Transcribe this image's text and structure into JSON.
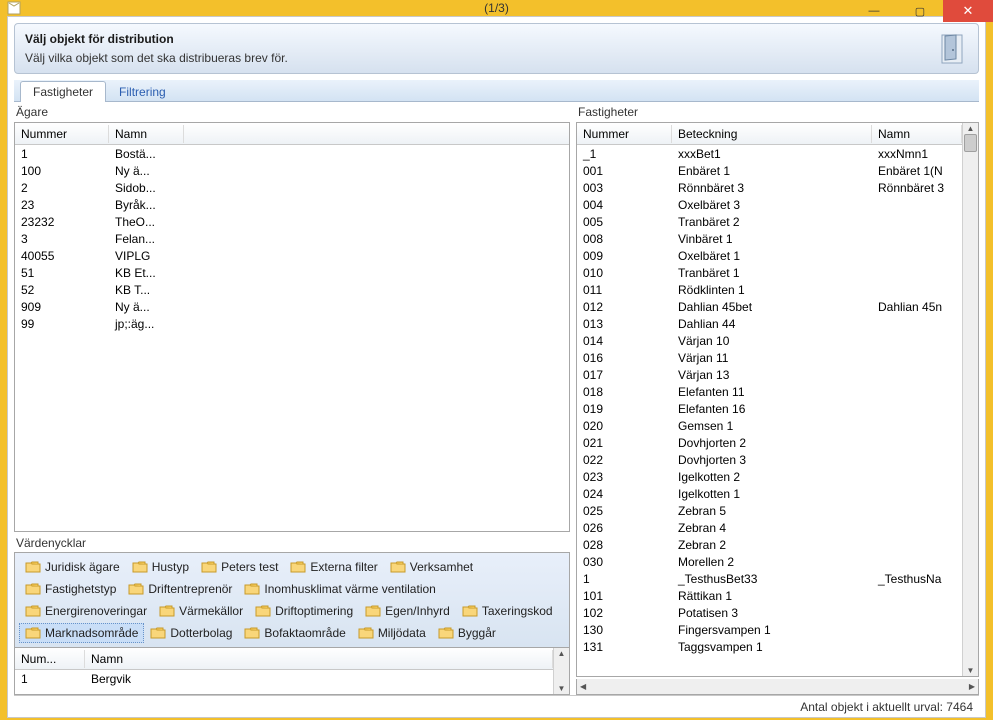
{
  "window": {
    "title": "(1/3)"
  },
  "header": {
    "title": "Välj objekt för distribution",
    "subtitle": "Välj vilka objekt som det ska distribueras brev för."
  },
  "tabs": [
    {
      "label": "Fastigheter",
      "active": true
    },
    {
      "label": "Filtrering",
      "active": false
    }
  ],
  "owners": {
    "label": "Ägare",
    "columns": {
      "num": "Nummer",
      "namn": "Namn"
    },
    "rows": [
      {
        "num": "1",
        "namn": "Bostä..."
      },
      {
        "num": "100",
        "namn": "Ny ä..."
      },
      {
        "num": "2",
        "namn": "Sidob..."
      },
      {
        "num": "23",
        "namn": "Byråk..."
      },
      {
        "num": "23232",
        "namn": "TheO..."
      },
      {
        "num": "3",
        "namn": "Felan..."
      },
      {
        "num": "40055",
        "namn": "VIPLG"
      },
      {
        "num": "51",
        "namn": "KB Et..."
      },
      {
        "num": "52",
        "namn": "KB T..."
      },
      {
        "num": "909",
        "namn": "Ny ä..."
      },
      {
        "num": "99",
        "namn": "jp;:äg..."
      }
    ]
  },
  "value_keys": {
    "label": "Värdenycklar",
    "items": [
      {
        "label": "Juridisk ägare"
      },
      {
        "label": "Hustyp"
      },
      {
        "label": "Peters test"
      },
      {
        "label": "Externa filter"
      },
      {
        "label": "Verksamhet"
      },
      {
        "label": "Fastighetstyp"
      },
      {
        "label": "Driftentreprenör"
      },
      {
        "label": "Inomhusklimat värme ventilation"
      },
      {
        "label": "Energirenoveringar"
      },
      {
        "label": "Värmekällor"
      },
      {
        "label": "Driftoptimering"
      },
      {
        "label": "Egen/Inhyrd"
      },
      {
        "label": "Taxeringskod"
      },
      {
        "label": "Marknadsområde",
        "selected": true
      },
      {
        "label": "Dotterbolag"
      },
      {
        "label": "Bofaktaområde"
      },
      {
        "label": "Miljödata"
      },
      {
        "label": "Byggår"
      }
    ],
    "grid": {
      "columns": {
        "num": "Num...",
        "namn": "Namn"
      },
      "rows": [
        {
          "num": "1",
          "namn": "Bergvik"
        }
      ]
    }
  },
  "properties": {
    "label": "Fastigheter",
    "columns": {
      "num": "Nummer",
      "bet": "Beteckning",
      "namn": "Namn"
    },
    "rows": [
      {
        "num": "_1",
        "bet": "xxxBet1",
        "namn": "xxxNmn1"
      },
      {
        "num": "001",
        "bet": "Enbäret 1",
        "namn": "Enbäret 1(N"
      },
      {
        "num": "003",
        "bet": "Rönnbäret 3",
        "namn": "Rönnbäret 3"
      },
      {
        "num": "004",
        "bet": "Oxelbäret 3",
        "namn": ""
      },
      {
        "num": "005",
        "bet": "Tranbäret 2",
        "namn": ""
      },
      {
        "num": "008",
        "bet": "Vinbäret 1",
        "namn": ""
      },
      {
        "num": "009",
        "bet": "Oxelbäret 1",
        "namn": ""
      },
      {
        "num": "010",
        "bet": "Tranbäret 1",
        "namn": ""
      },
      {
        "num": "011",
        "bet": "Rödklinten 1",
        "namn": ""
      },
      {
        "num": "012",
        "bet": "Dahlian 45bet",
        "namn": "Dahlian 45n"
      },
      {
        "num": "013",
        "bet": "Dahlian 44",
        "namn": ""
      },
      {
        "num": "014",
        "bet": "Värjan 10",
        "namn": ""
      },
      {
        "num": "016",
        "bet": "Värjan 11",
        "namn": ""
      },
      {
        "num": "017",
        "bet": "Värjan 13",
        "namn": ""
      },
      {
        "num": "018",
        "bet": "Elefanten 11",
        "namn": ""
      },
      {
        "num": "019",
        "bet": "Elefanten 16",
        "namn": ""
      },
      {
        "num": "020",
        "bet": "Gemsen 1",
        "namn": ""
      },
      {
        "num": "021",
        "bet": "Dovhjorten 2",
        "namn": ""
      },
      {
        "num": "022",
        "bet": "Dovhjorten 3",
        "namn": ""
      },
      {
        "num": "023",
        "bet": "Igelkotten 2",
        "namn": ""
      },
      {
        "num": "024",
        "bet": "Igelkotten 1",
        "namn": ""
      },
      {
        "num": "025",
        "bet": "Zebran 5",
        "namn": ""
      },
      {
        "num": "026",
        "bet": "Zebran 4",
        "namn": ""
      },
      {
        "num": "028",
        "bet": "Zebran 2",
        "namn": ""
      },
      {
        "num": "030",
        "bet": "Morellen 2",
        "namn": ""
      },
      {
        "num": "1",
        "bet": "_TesthusBet33",
        "namn": "_TesthusNa"
      },
      {
        "num": "101",
        "bet": "Rättikan 1",
        "namn": ""
      },
      {
        "num": "102",
        "bet": "Potatisen 3",
        "namn": ""
      },
      {
        "num": "130",
        "bet": "Fingersvampen 1",
        "namn": ""
      },
      {
        "num": "131",
        "bet": "Taggsvampen 1",
        "namn": ""
      }
    ]
  },
  "status": {
    "count_label": "Antal objekt i aktuellt urval: 7464"
  }
}
